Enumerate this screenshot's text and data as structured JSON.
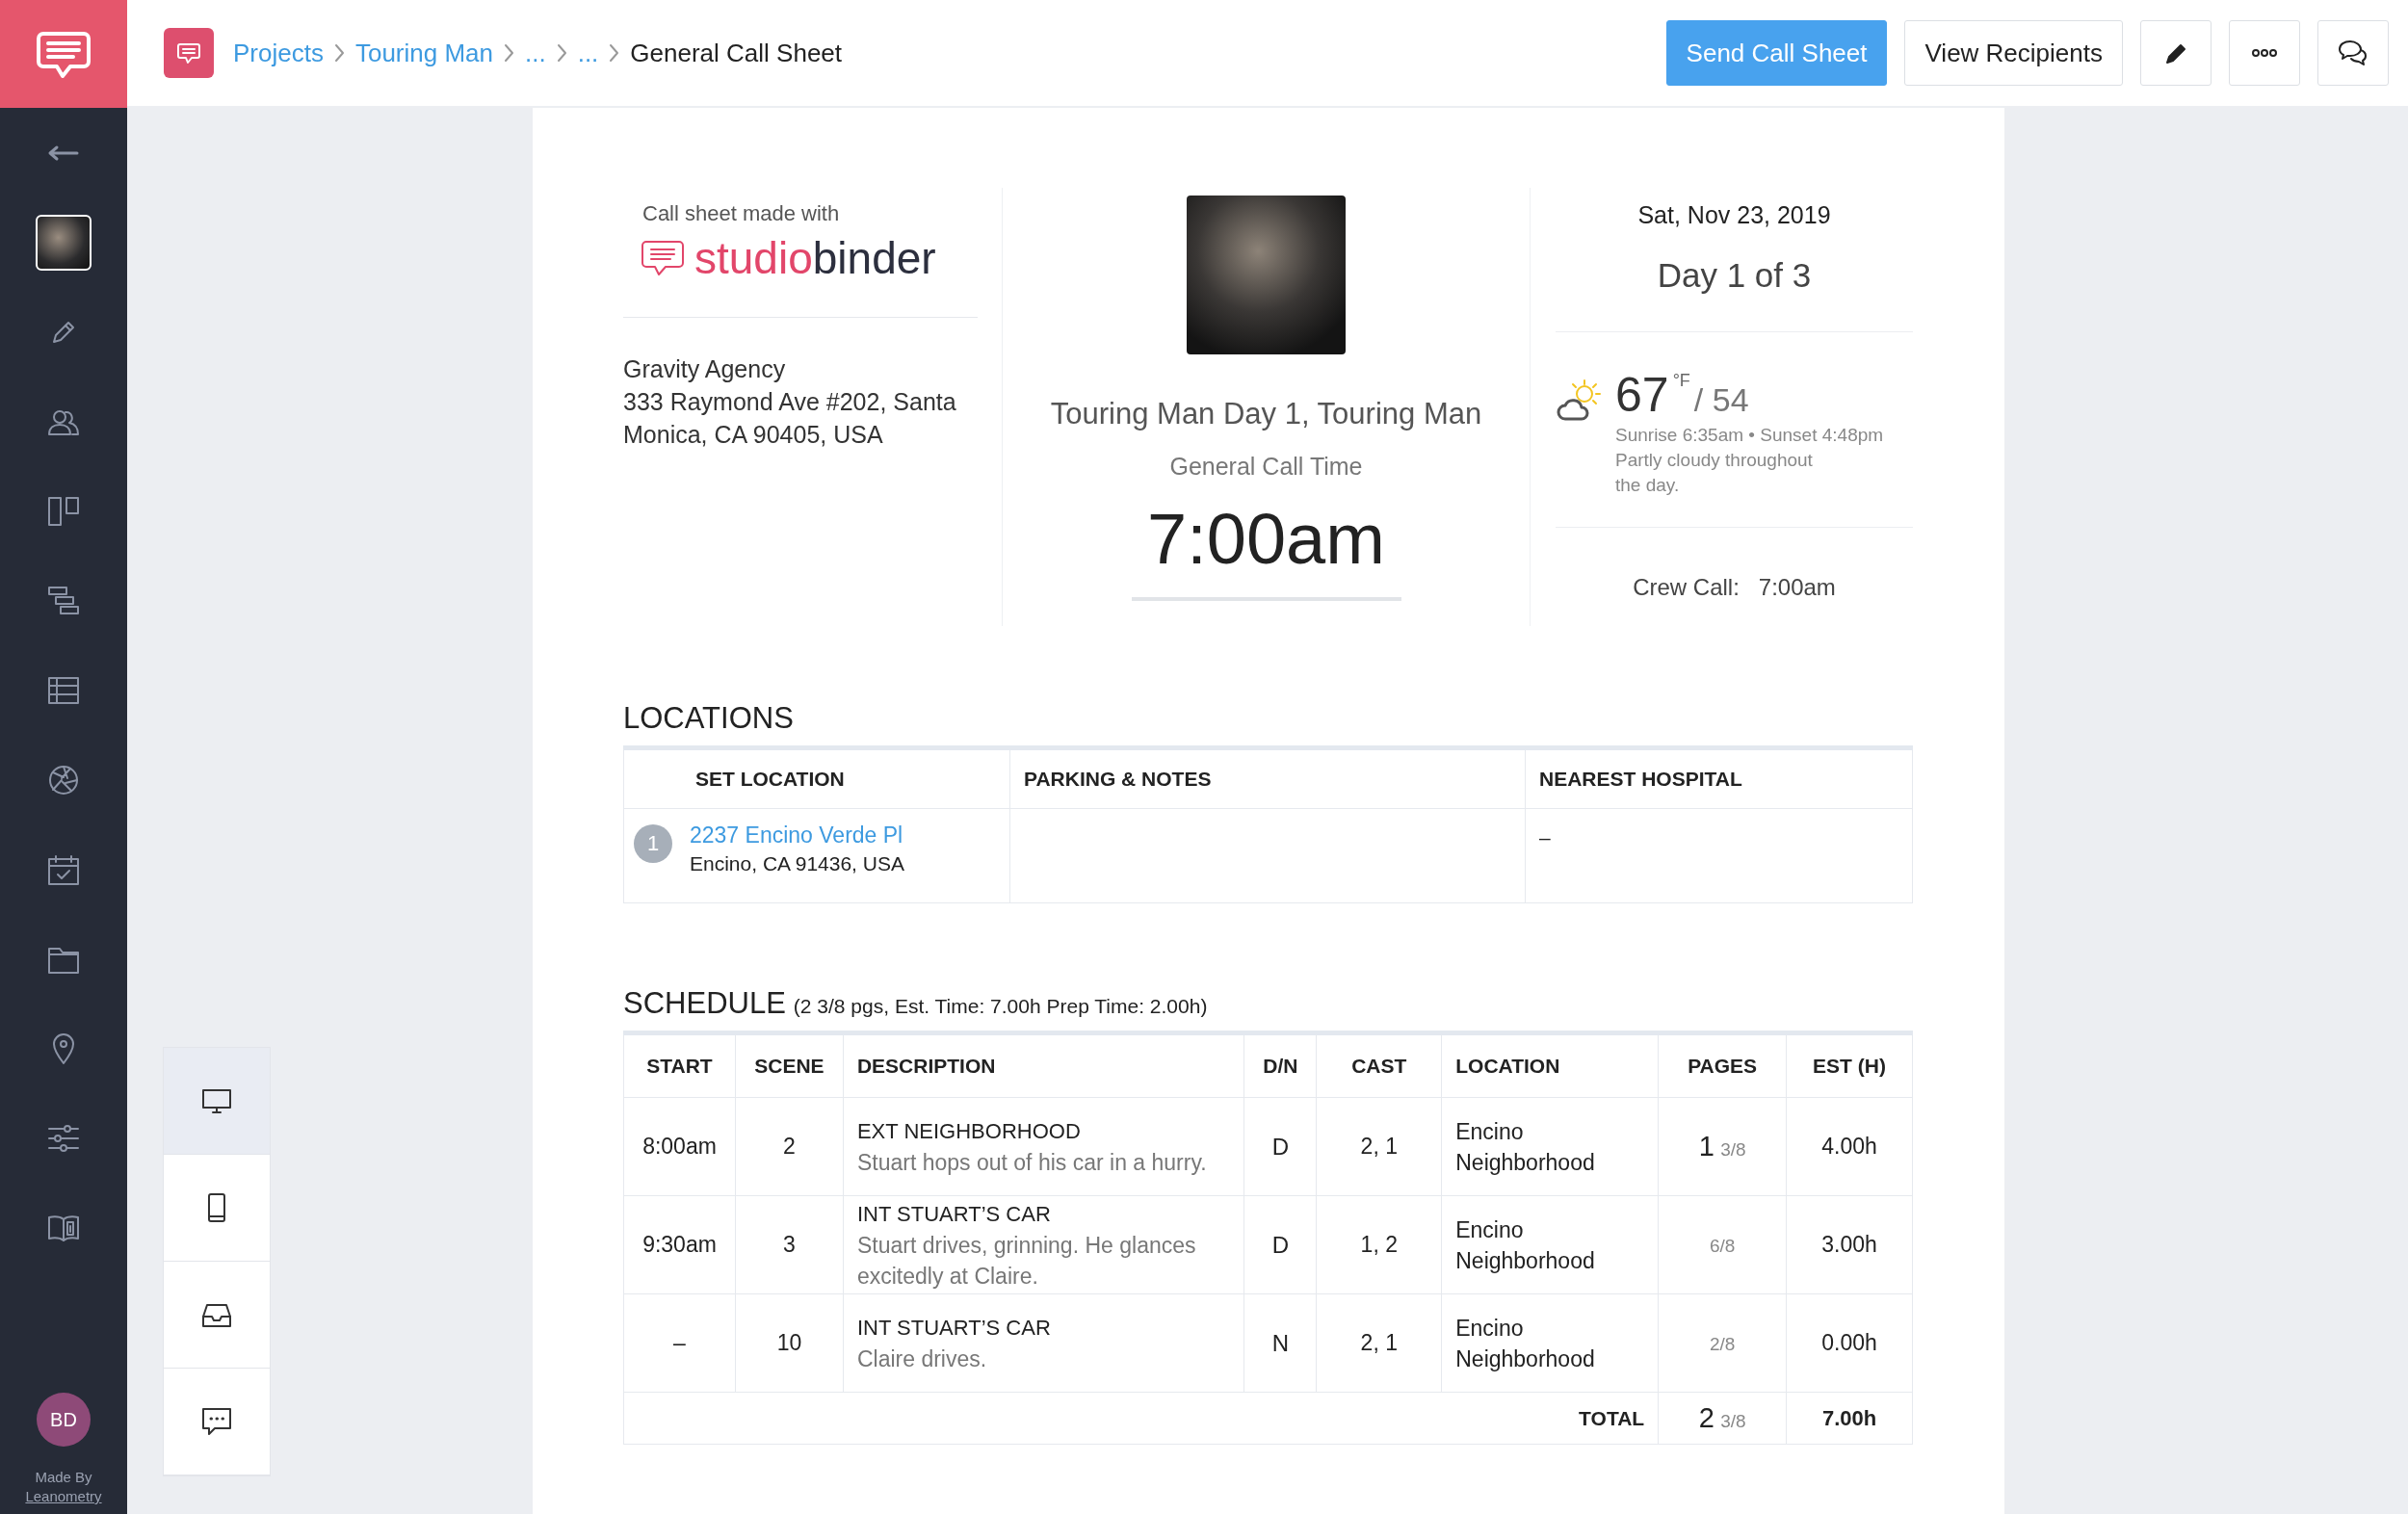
{
  "sidebar": {
    "avatar": "BD",
    "credit_label": "Made By",
    "credit_link": "Leanometry"
  },
  "breadcrumb": [
    {
      "label": "Projects",
      "current": false
    },
    {
      "label": "Touring Man",
      "current": false
    },
    {
      "label": "...",
      "current": false
    },
    {
      "label": "...",
      "current": false
    },
    {
      "label": "General Call Sheet",
      "current": true
    }
  ],
  "actions": [
    {
      "label": "Send Call Sheet",
      "kind": "primary"
    },
    {
      "label": "View Recipients",
      "kind": "secondary"
    }
  ],
  "view_modes": [
    {
      "selected": true
    },
    {
      "selected": false
    },
    {
      "selected": false
    },
    {
      "selected": false
    }
  ],
  "call_sheet": {
    "made_with": "Call sheet made with",
    "brand": {
      "first": "studio",
      "second": "binder"
    },
    "company": "Gravity Agency",
    "address": "333 Raymond Ave #202, Santa Monica, CA 90405, USA",
    "project_title": "Touring Man Day 1, Touring Man",
    "call_time_label": "General Call Time",
    "call_time": "7:00am",
    "date": "Sat, Nov 23, 2019",
    "day": "Day 1 of 3",
    "weather": {
      "high": "67",
      "unit": "°F",
      "low": "/ 54",
      "sun": "Sunrise 6:35am • Sunset 4:48pm",
      "summary": "Partly cloudy throughout the day."
    },
    "crew_call": {
      "label": "Crew Call:",
      "value": "7:00am"
    }
  },
  "locations": {
    "title": "LOCATIONS",
    "columns": [
      "SET LOCATION",
      "PARKING & NOTES",
      "NEAREST HOSPITAL"
    ],
    "rows": [
      {
        "number": "1",
        "name": "2237 Encino Verde Pl",
        "address": "Encino, CA 91436, USA",
        "hospital": "–"
      }
    ]
  },
  "schedule": {
    "title": "SCHEDULE",
    "summary": "(2 3/8 pgs, Est. Time: 7.00h Prep Time: 2.00h)",
    "columns": [
      "START",
      "SCENE",
      "DESCRIPTION",
      "D/N",
      "CAST",
      "LOCATION",
      "PAGES",
      "EST (H)"
    ],
    "rows": [
      {
        "start": "8:00am",
        "scene": "2",
        "heading": "EXT NEIGHBORHOOD",
        "description": "Stuart hops out of his car in a hurry.",
        "dn": "D",
        "cast": "2, 1",
        "location": "Encino Neighborhood",
        "pages_whole": "1",
        "pages_fraction": "3/8",
        "est": "4.00h"
      },
      {
        "start": "9:30am",
        "scene": "3",
        "heading": "INT STUART’S CAR",
        "description": "Stuart drives, grinning. He glances excitedly at Claire.",
        "dn": "D",
        "cast": "1, 2",
        "location": "Encino Neighborhood",
        "pages_fraction": "6/8",
        "est": "3.00h"
      },
      {
        "start": "–",
        "scene": "10",
        "heading": "INT STUART’S CAR",
        "description": "Claire drives.",
        "dn": "N",
        "cast": "2, 1",
        "location": "Encino Neighborhood",
        "pages_fraction": "2/8",
        "est": "0.00h"
      }
    ],
    "total": {
      "label": "TOTAL",
      "pages_whole": "2",
      "pages_fraction": "3/8",
      "est": "7.00h"
    }
  }
}
